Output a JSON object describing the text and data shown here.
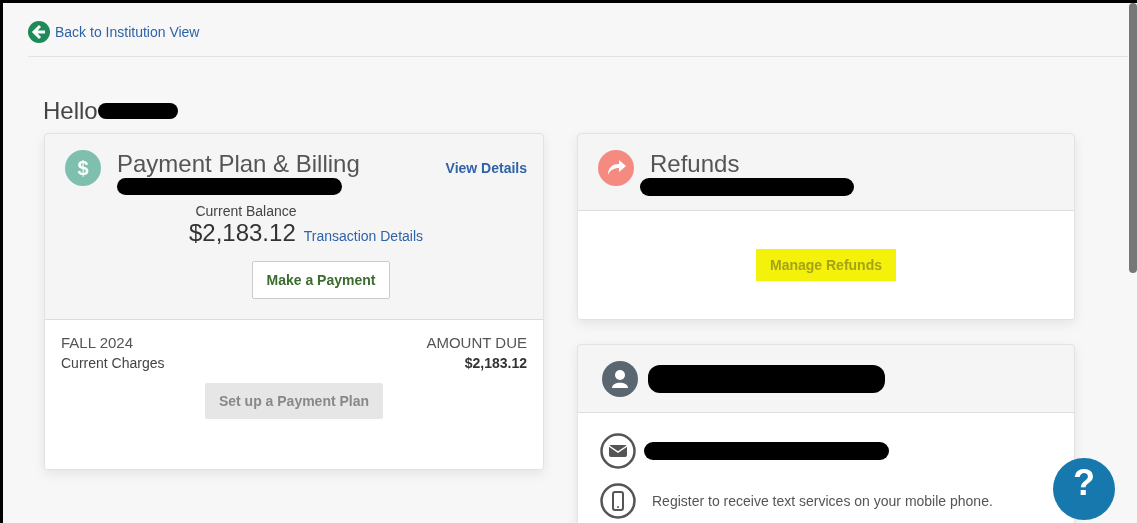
{
  "back_link": "Back to Institution View",
  "greeting": "Hello",
  "billing_card": {
    "icon": "$",
    "title": "Payment Plan & Billing",
    "view_details": "View Details",
    "balance_label": "Current Balance",
    "balance": "$2,183.12",
    "transaction_link": "Transaction Details",
    "pay_button": "Make a Payment",
    "term": "FALL 2024",
    "charges_label": "Current Charges",
    "amount_due_label": "AMOUNT DUE",
    "amount_due": "$2,183.12",
    "plan_button": {
      "label": "Set up a Payment Plan",
      "disabled": true
    }
  },
  "refunds_card": {
    "title": "Refunds",
    "button": {
      "label": "Manage Refunds",
      "disabled": true,
      "highlighted": true
    }
  },
  "profile_card": {
    "sms_text": "Register to receive text services on your mobile phone."
  },
  "help_button": "?"
}
